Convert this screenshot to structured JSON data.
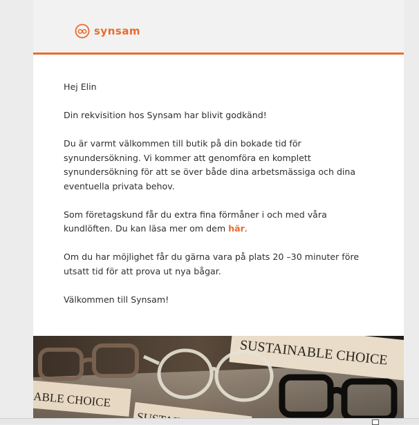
{
  "brand": {
    "name": "synsam",
    "accent_color": "#ea6b2a",
    "logo_icon": "synsam-glasses-logo-icon"
  },
  "email": {
    "greeting": "Hej Elin",
    "p1": "Din rekvisition hos Synsam har blivit godkänd!",
    "p2": "Du är varmt välkommen till butik på din bokade tid för synundersökning. Vi kommer att genomföra en komplett synundersökning för att se över både dina arbetsmässiga och dina eventuella privata behov.",
    "p3_before": "Som företagskund får du extra fina förmåner i och med våra kundlöften. Du kan läsa mer om dem ",
    "p3_link": "här",
    "p3_after": ".",
    "p4": "Om du har möjlighet får du gärna vara på plats 20 –30 minuter före utsatt tid för att prova ut nya bågar.",
    "p5": "Välkommen till Synsam!"
  },
  "banner": {
    "sign_top": "SUSTAINABLE CHOICE",
    "sign_left": "ABLE CHOICE",
    "sign_bottom": "SUSTAIN"
  }
}
